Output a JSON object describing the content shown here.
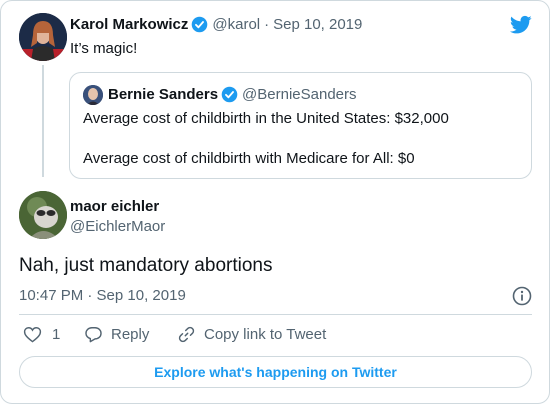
{
  "parent_tweet": {
    "author_name": "Karol Markowicz",
    "handle": "@karol",
    "separator": "·",
    "date": "Sep 10, 2019",
    "text": "It’s magic!",
    "quoted_tweet": {
      "author_name": "Bernie Sanders",
      "handle": "@BernieSanders",
      "line1": "Average cost of childbirth in the United States: $32,000",
      "line2": "Average cost of childbirth with Medicare for All: $0"
    }
  },
  "main_tweet": {
    "author_name": "maor eichler",
    "handle": "@EichlerMaor",
    "text": "Nah, just mandatory abortions",
    "timestamp": "10:47 PM · Sep 10, 2019"
  },
  "actions": {
    "like_count": "1",
    "reply_label": "Reply",
    "copy_link_label": "Copy link to Tweet"
  },
  "footer": {
    "explore_label": "Explore what's happening on Twitter"
  },
  "colors": {
    "accent": "#1d9bf0",
    "text": "#0f1419",
    "muted": "#536471",
    "border": "#cfd9de"
  },
  "icons": {
    "verified": "verified-badge-icon",
    "brand": "twitter-bird-icon",
    "info": "info-icon",
    "like": "heart-icon",
    "reply": "speech-bubble-icon",
    "copy_link": "link-icon"
  }
}
